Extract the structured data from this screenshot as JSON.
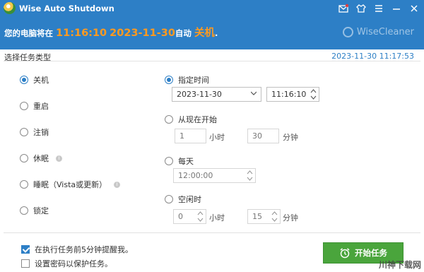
{
  "window": {
    "title": "Wise Auto Shutdown",
    "icons": [
      "mail-icon",
      "shirt-icon",
      "menu-icon",
      "minimize-icon",
      "close-icon"
    ]
  },
  "banner": {
    "prefix": "您的电脑将在",
    "time": "11:16:10",
    "date": "2023-11-30",
    "middle": "自动",
    "action": "关机",
    "suffix": ".",
    "brand": "WiseCleaner"
  },
  "task": {
    "section_label": "选择任务类型",
    "current_time": "2023-11-30 11:17:53",
    "types": [
      {
        "label": "关机",
        "selected": true,
        "info": false
      },
      {
        "label": "重启",
        "selected": false,
        "info": false
      },
      {
        "label": "注销",
        "selected": false,
        "info": false
      },
      {
        "label": "休眠",
        "selected": false,
        "info": true
      },
      {
        "label": "睡眠（Vista或更新）",
        "selected": false,
        "info": true
      },
      {
        "label": "锁定",
        "selected": false,
        "info": false
      }
    ]
  },
  "schedule": {
    "specific": {
      "label": "指定时间",
      "selected": true,
      "date": "2023-11-30",
      "time": "11:16:10"
    },
    "from_now": {
      "label": "从现在开始",
      "selected": false,
      "hours": "1",
      "hours_unit": "小时",
      "minutes": "30",
      "minutes_unit": "分钟"
    },
    "daily": {
      "label": "每天",
      "selected": false,
      "time": "12:00:00"
    },
    "idle": {
      "label": "空闲时",
      "selected": false,
      "hours": "0",
      "hours_unit": "小时",
      "minutes": "15",
      "minutes_unit": "分钟"
    }
  },
  "footer": {
    "remind_label": "在执行任务前5分钟提醒我。",
    "remind_checked": true,
    "password_label": "设置密码以保护任务。",
    "password_checked": false,
    "start_button": "开始任务"
  },
  "watermark": "川神下载网",
  "colors": {
    "accent": "#2d7fc6",
    "highlight": "#ff9a1f",
    "start": "#4aa53c"
  }
}
